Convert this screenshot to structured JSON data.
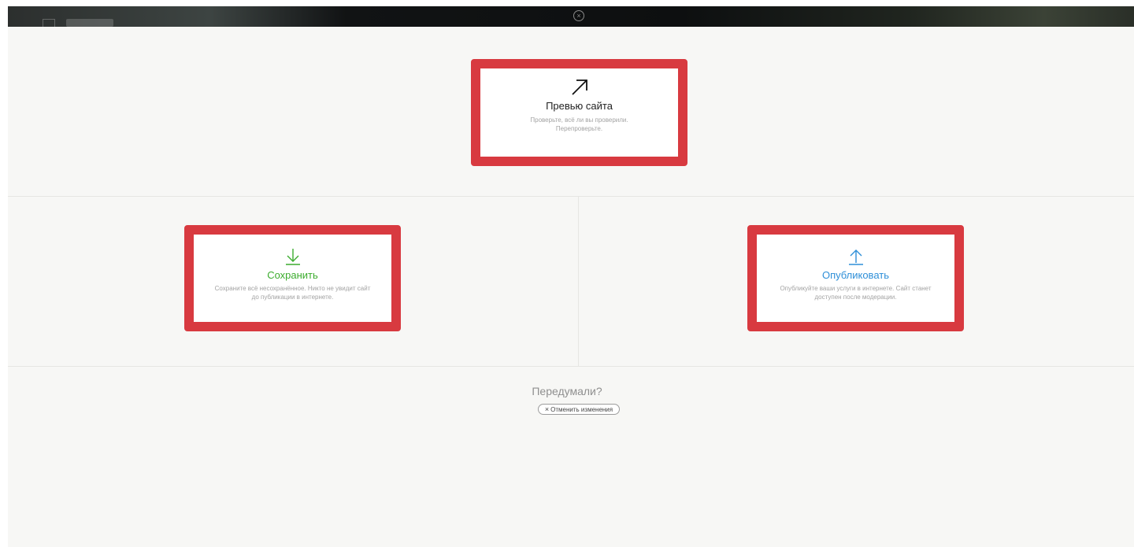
{
  "header": {
    "close_icon": "close-icon"
  },
  "preview": {
    "icon": "arrow-up-right-icon",
    "title": "Превью сайта",
    "description": "Проверьте, всё ли вы проверили. Перепроверьте."
  },
  "save": {
    "icon": "arrow-down-icon",
    "title": "Сохранить",
    "description": "Сохраните всё несохранённое. Никто не увидит сайт до публикации в интернете.",
    "color": "#3cac2e"
  },
  "publish": {
    "icon": "arrow-up-icon",
    "title": "Опубликовать",
    "description": "Опубликуйте ваши услуги в интернете. Сайт станет доступен после модерации.",
    "color": "#2e8fd8"
  },
  "footer": {
    "question": "Передумали?",
    "cancel_icon": "x-icon",
    "cancel_label": "Отменить изменения"
  },
  "colors": {
    "highlight_border": "#d83a40",
    "panel_bg": "#f7f7f5"
  }
}
